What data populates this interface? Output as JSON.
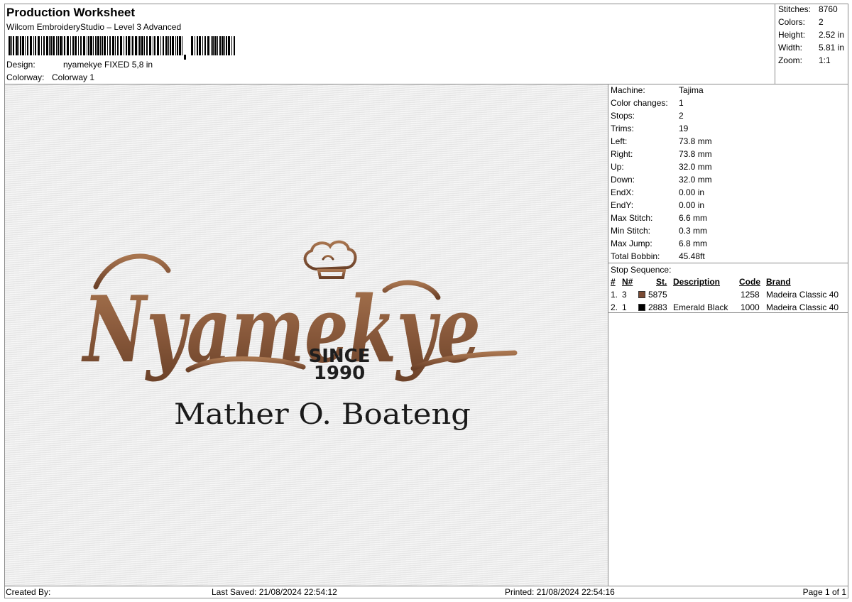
{
  "header": {
    "title": "Production Worksheet",
    "software": "Wilcom EmbroideryStudio – Level 3 Advanced",
    "design_label": "Design:",
    "design_value": "nyamekye FIXED 5,8 in",
    "colorway_label": "Colorway:",
    "colorway_value": "Colorway 1"
  },
  "summary": [
    {
      "label": "Stitches:",
      "value": "8760"
    },
    {
      "label": "Colors:",
      "value": "2"
    },
    {
      "label": "Height:",
      "value": "2.52 in"
    },
    {
      "label": "Width:",
      "value": "5.81 in"
    },
    {
      "label": "Zoom:",
      "value": "1:1"
    }
  ],
  "parameters": [
    {
      "label": "Machine:",
      "value": "Tajima"
    },
    {
      "label": "Color changes:",
      "value": "1"
    },
    {
      "label": "Stops:",
      "value": "2"
    },
    {
      "label": "Trims:",
      "value": "19"
    },
    {
      "label": "Left:",
      "value": "73.8 mm"
    },
    {
      "label": "Right:",
      "value": "73.8 mm"
    },
    {
      "label": "Up:",
      "value": "32.0 mm"
    },
    {
      "label": "Down:",
      "value": "32.0 mm"
    },
    {
      "label": "EndX:",
      "value": "0.00 in"
    },
    {
      "label": "EndY:",
      "value": "0.00 in"
    },
    {
      "label": "Max Stitch:",
      "value": "6.6 mm"
    },
    {
      "label": "Min Stitch:",
      "value": "0.3 mm"
    },
    {
      "label": "Max Jump:",
      "value": "6.8 mm"
    },
    {
      "label": "Total Bobbin:",
      "value": "45.48ft"
    }
  ],
  "stop_sequence": {
    "title": "Stop Sequence:",
    "headers": {
      "num": "#",
      "n": "N#",
      "st": "St.",
      "desc": "Description",
      "code": "Code",
      "brand": "Brand"
    },
    "rows": [
      {
        "num": "1.",
        "n": "3",
        "color": "#7a4a33",
        "st": "5875",
        "desc": "",
        "code": "1258",
        "brand": "Madeira Classic 40"
      },
      {
        "num": "2.",
        "n": "1",
        "color": "#000000",
        "st": "2883",
        "desc": "Emerald Black",
        "code": "1000",
        "brand": "Madeira Classic 40"
      }
    ]
  },
  "design": {
    "logo_text": "Nyamekye",
    "since_text": "SINCE",
    "year_text": "1990",
    "name_text": "Mather O. Boateng",
    "thread_brown": "#8a5a3c",
    "thread_black": "#1a1a1a"
  },
  "footer": {
    "created_by": "Created By:",
    "last_saved": "Last Saved: 21/08/2024 22:54:12",
    "printed": "Printed: 21/08/2024 22:54:16",
    "page": "Page 1 of 1"
  }
}
